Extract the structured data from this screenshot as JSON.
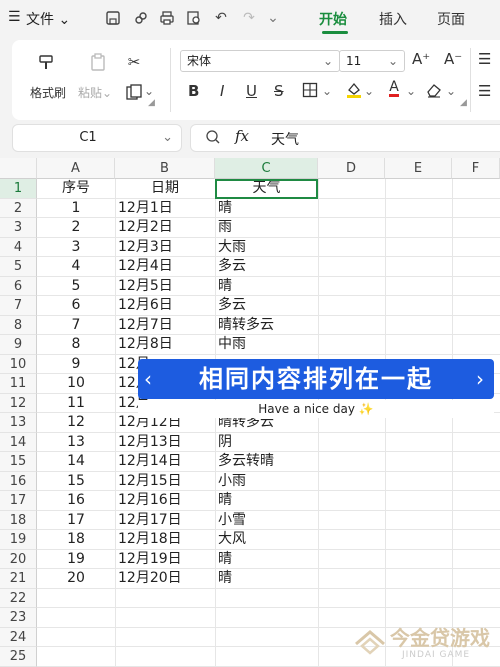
{
  "menu": {
    "hamburger_icon": "menu-icon",
    "file": "文件",
    "tabs": [
      "开始",
      "插入",
      "页面"
    ]
  },
  "ribbon": {
    "format_painter": "格式刷",
    "paste": "粘贴",
    "font_name": "宋体",
    "font_size": "11",
    "bold": "B",
    "italic": "I",
    "underline": "U",
    "strike": "S",
    "grow": "A⁺",
    "shrink": "A⁻",
    "font_color_letter": "A"
  },
  "formula_bar": {
    "cell_ref": "C1",
    "fx": "fx",
    "value": "天气"
  },
  "sheet": {
    "columns": [
      "A",
      "B",
      "C",
      "D",
      "E",
      "F"
    ],
    "rows": [
      "1",
      "2",
      "3",
      "4",
      "5",
      "6",
      "7",
      "8",
      "9",
      "10",
      "11",
      "12",
      "13",
      "14",
      "15",
      "16",
      "17",
      "18",
      "19",
      "20",
      "21",
      "22",
      "23",
      "24",
      "25"
    ],
    "data": [
      [
        "序号",
        "日期",
        "天气"
      ],
      [
        "1",
        "12月1日",
        "晴"
      ],
      [
        "2",
        "12月2日",
        "雨"
      ],
      [
        "3",
        "12月3日",
        "大雨"
      ],
      [
        "4",
        "12月4日",
        "多云"
      ],
      [
        "5",
        "12月5日",
        "晴"
      ],
      [
        "6",
        "12月6日",
        "多云"
      ],
      [
        "7",
        "12月7日",
        "晴转多云"
      ],
      [
        "8",
        "12月8日",
        "中雨"
      ],
      [
        "9",
        "12月",
        ""
      ],
      [
        "10",
        "12月",
        ""
      ],
      [
        "11",
        "12月",
        ""
      ],
      [
        "12",
        "12月12日",
        "晴转多云"
      ],
      [
        "13",
        "12月13日",
        "阴"
      ],
      [
        "14",
        "12月14日",
        "多云转晴"
      ],
      [
        "15",
        "12月15日",
        "小雨"
      ],
      [
        "16",
        "12月16日",
        "晴"
      ],
      [
        "17",
        "12月17日",
        "小雪"
      ],
      [
        "18",
        "12月18日",
        "大风"
      ],
      [
        "19",
        "12月19日",
        "晴"
      ],
      [
        "20",
        "12月20日",
        "晴"
      ]
    ]
  },
  "overlay": {
    "banner": "相同内容排列在一起",
    "caption": "Have a nice day"
  },
  "watermark": {
    "cn": "今金贷游戏",
    "en": "JINDAI GAME"
  },
  "colors": {
    "accent": "#1a8d3e",
    "banner": "#1d5ce0",
    "highlight": "#f5d400",
    "font_red": "#e02020"
  }
}
